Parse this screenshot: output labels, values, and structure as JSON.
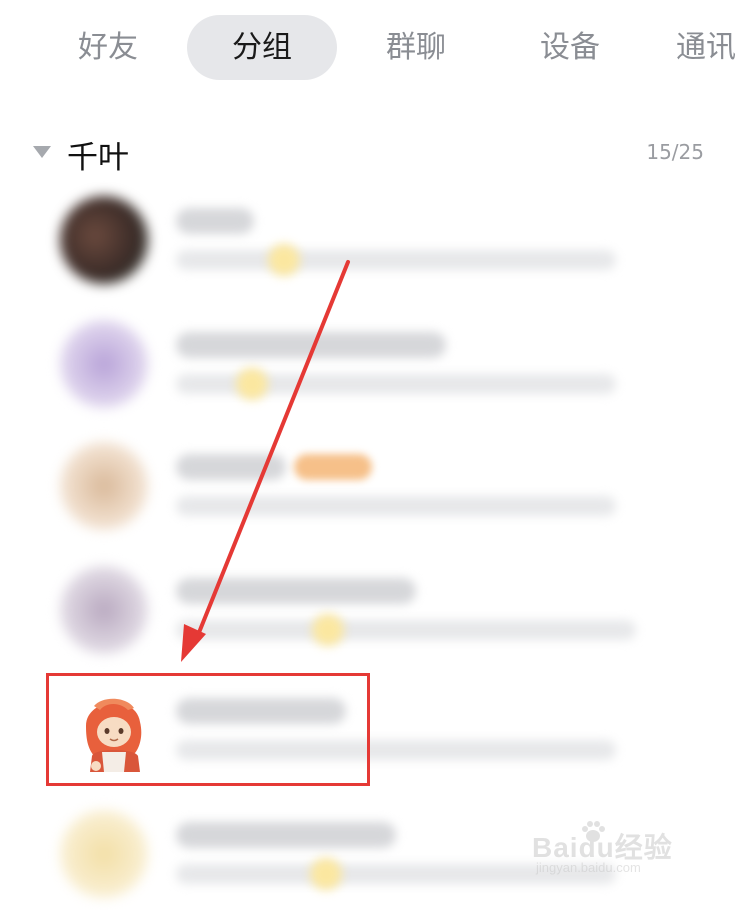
{
  "tabs": [
    {
      "label": "好友",
      "active": false
    },
    {
      "label": "分组",
      "active": true
    },
    {
      "label": "群聊",
      "active": false
    },
    {
      "label": "设备",
      "active": false
    },
    {
      "label": "通讯",
      "active": false
    }
  ],
  "group": {
    "name": "千叶",
    "count": "15/25",
    "expanded": true
  },
  "contacts_note": "contact names and signatures are blurred in the screenshot",
  "highlight_color": "#e53935",
  "arrow_color": "#e53935",
  "watermark": {
    "brand": "Baidu经验",
    "sub": "jingyan.baidu.com"
  }
}
